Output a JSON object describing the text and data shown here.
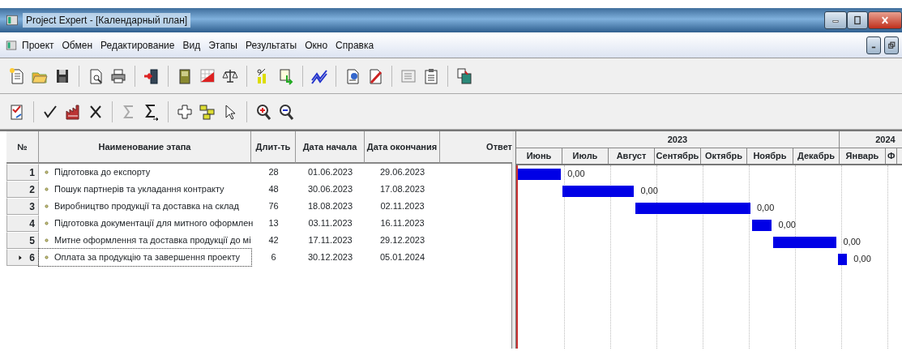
{
  "window": {
    "title": "Project Expert - [Календарный план]"
  },
  "menu": [
    "Проект",
    "Обмен",
    "Редактирование",
    "Вид",
    "Этапы",
    "Результаты",
    "Окно",
    "Справка"
  ],
  "table": {
    "columns": [
      "№",
      "Наименование этапа",
      "Длит-ть",
      "Дата начала",
      "Дата окончания",
      "Ответ"
    ],
    "rows": [
      {
        "number": "1",
        "name": "Підготовка до експорту",
        "duration": "28",
        "start": "01.06.2023",
        "end": "29.06.2023",
        "selected": false
      },
      {
        "number": "2",
        "name": "Пошук партнерів та укладання контракту",
        "duration": "48",
        "start": "30.06.2023",
        "end": "17.08.2023",
        "selected": false
      },
      {
        "number": "3",
        "name": "Виробництво продукції та доставка на склад",
        "duration": "76",
        "start": "18.08.2023",
        "end": "02.11.2023",
        "selected": false
      },
      {
        "number": "4",
        "name": "Підготовка документації для митного оформлен",
        "duration": "13",
        "start": "03.11.2023",
        "end": "16.11.2023",
        "selected": false
      },
      {
        "number": "5",
        "name": "Митне оформлення та доставка продукції до мі",
        "duration": "42",
        "start": "17.11.2023",
        "end": "29.12.2023",
        "selected": false
      },
      {
        "number": "6",
        "name": "Оплата за продукцію та завершення проекту",
        "duration": "6",
        "start": "30.12.2023",
        "end": "05.01.2024",
        "selected": true
      }
    ]
  },
  "gantt": {
    "years": [
      {
        "label": "2023",
        "months": [
          "Июнь",
          "Июль",
          "Август",
          "Сентябрь",
          "Октябрь",
          "Ноябрь",
          "Декабрь"
        ]
      },
      {
        "label": "2024",
        "months": [
          "Январь",
          "Ф"
        ]
      }
    ],
    "bar_labels": [
      "0,00",
      "0,00",
      "0,00",
      "0,00",
      "0,00",
      "0,00"
    ]
  }
}
